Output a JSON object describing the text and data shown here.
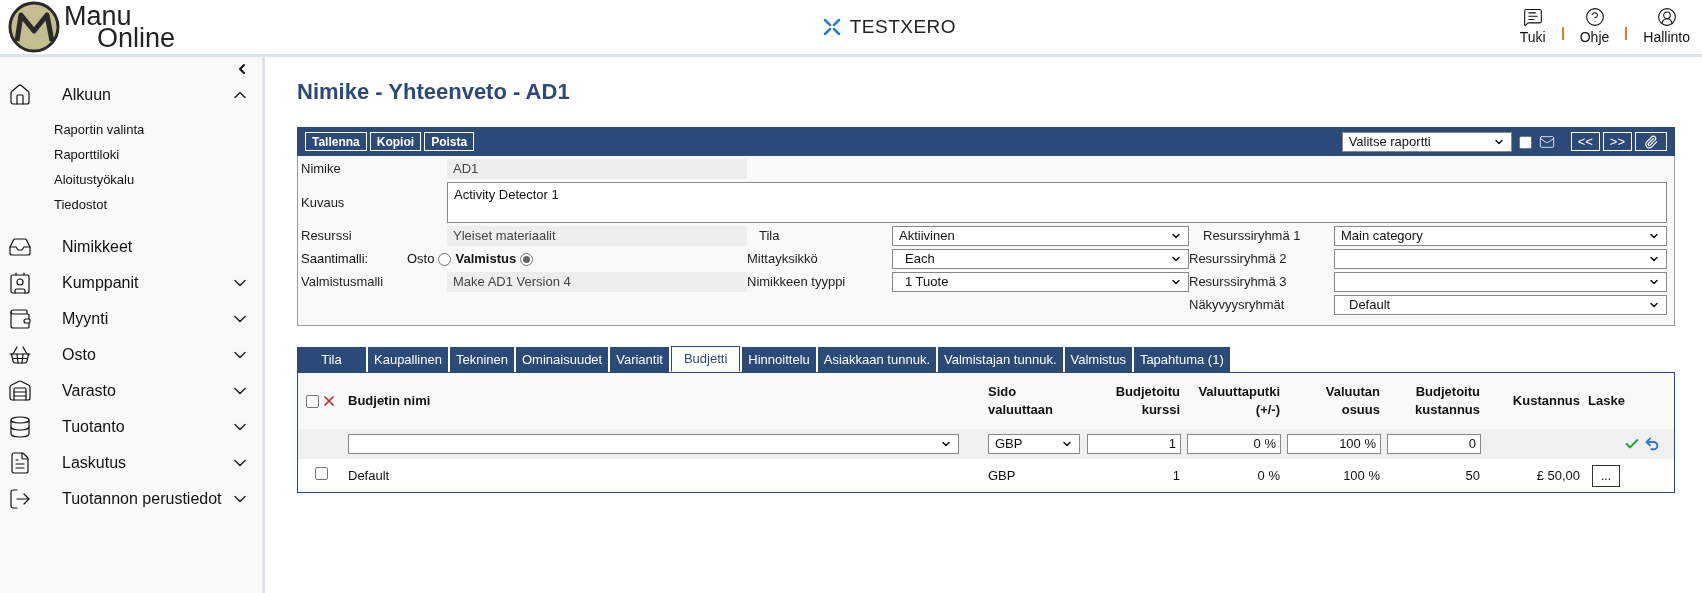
{
  "header": {
    "logo_line1": "Manu",
    "logo_line2": "Online",
    "company": "TESTXERO",
    "actions": [
      {
        "label": "Tuki"
      },
      {
        "label": "Ohje"
      },
      {
        "label": "Hallinto"
      }
    ]
  },
  "sidebar": {
    "items": [
      {
        "label": "Alkuun",
        "expanded": true,
        "children": [
          {
            "label": "Raportin valinta"
          },
          {
            "label": "Raporttiloki"
          },
          {
            "label": "Aloitustyökalu"
          },
          {
            "label": "Tiedostot"
          }
        ]
      },
      {
        "label": "Nimikkeet"
      },
      {
        "label": "Kumppanit",
        "expanded": false
      },
      {
        "label": "Myynti",
        "expanded": false
      },
      {
        "label": "Osto",
        "expanded": false
      },
      {
        "label": "Varasto",
        "expanded": false
      },
      {
        "label": "Tuotanto",
        "expanded": false
      },
      {
        "label": "Laskutus",
        "expanded": false
      },
      {
        "label": "Tuotannon perustiedot",
        "expanded": false
      }
    ]
  },
  "page_title": "Nimike - Yhteenveto - AD1",
  "toolbar": {
    "buttons": [
      "Tallenna",
      "Kopioi",
      "Poista"
    ],
    "report_select": "Valitse raportti",
    "email_checked": false,
    "nav_buttons": [
      "<<",
      ">>"
    ]
  },
  "form": {
    "nimike": {
      "label": "Nimike",
      "value": "AD1"
    },
    "kuvaus": {
      "label": "Kuvaus",
      "value": "Activity Detector 1"
    },
    "left": [
      {
        "kind": "readonly",
        "label": "Resurssi",
        "value": "Yleiset materiaalit"
      },
      {
        "kind": "radio",
        "label": "Saantimalli:",
        "options": [
          {
            "label": "Osto",
            "selected": false
          },
          {
            "label": "Valmistus",
            "selected": true
          }
        ]
      },
      {
        "kind": "readonly",
        "label": "Valmistusmalli",
        "value": "Make AD1 Version 4"
      }
    ],
    "middle": [
      {
        "label": "Tila",
        "value": "Aktiivinen"
      },
      {
        "label": "Mittayksikkö",
        "value": "Each"
      },
      {
        "label": "Nimikkeen tyyppi",
        "value": "1 Tuote"
      }
    ],
    "right": [
      {
        "label": "Resurssiryhmä 1",
        "value": "Main category"
      },
      {
        "label": "Resurssiryhmä 2"
      },
      {
        "label": "Resurssiryhmä 3"
      },
      {
        "label": "Näkyvyysryhmät",
        "value": "Default"
      }
    ]
  },
  "tabs": [
    {
      "label": "Tila",
      "selected": false
    },
    {
      "label": "Kaupallinen",
      "selected": false
    },
    {
      "label": "Tekninen",
      "selected": false
    },
    {
      "label": "Ominaisuudet",
      "selected": false
    },
    {
      "label": "Variantit",
      "selected": false
    },
    {
      "label": "Budjetti",
      "selected": true
    },
    {
      "label": "Hinnoittelu",
      "selected": false
    },
    {
      "label": "Asiakkaan tunnuk.",
      "selected": false
    },
    {
      "label": "Valmistajan tunnuk.",
      "selected": false
    },
    {
      "label": "Valmistus",
      "selected": false
    },
    {
      "label": "Tapahtuma (1)",
      "selected": false
    }
  ],
  "table": {
    "select_all_checked": false,
    "columns": [
      {
        "line1": "Budjetin nimi"
      },
      {
        "line1": "Sido",
        "line2": "valuuttaan"
      },
      {
        "line1": "Budjetoitu",
        "line2": "kurssi"
      },
      {
        "line1": "Valuuttaputki",
        "line2": "(+/-)"
      },
      {
        "line1": "Valuutan",
        "line2": "osuus"
      },
      {
        "line1": "Budjetoitu",
        "line2": "kustannus"
      },
      {
        "line1": "Kustannus"
      },
      {
        "line1": "Laske"
      }
    ],
    "edit_row": {
      "currency": "GBP",
      "rate": "1",
      "pipe": "0 %",
      "share": "100 %",
      "budget": "0"
    },
    "rows": [
      {
        "checked": false,
        "name": "Default",
        "currency": "GBP",
        "rate": "1",
        "pipe": "0 %",
        "share": "100 %",
        "budget": "50",
        "cost": "£ 50,00",
        "calc": "..."
      }
    ]
  }
}
